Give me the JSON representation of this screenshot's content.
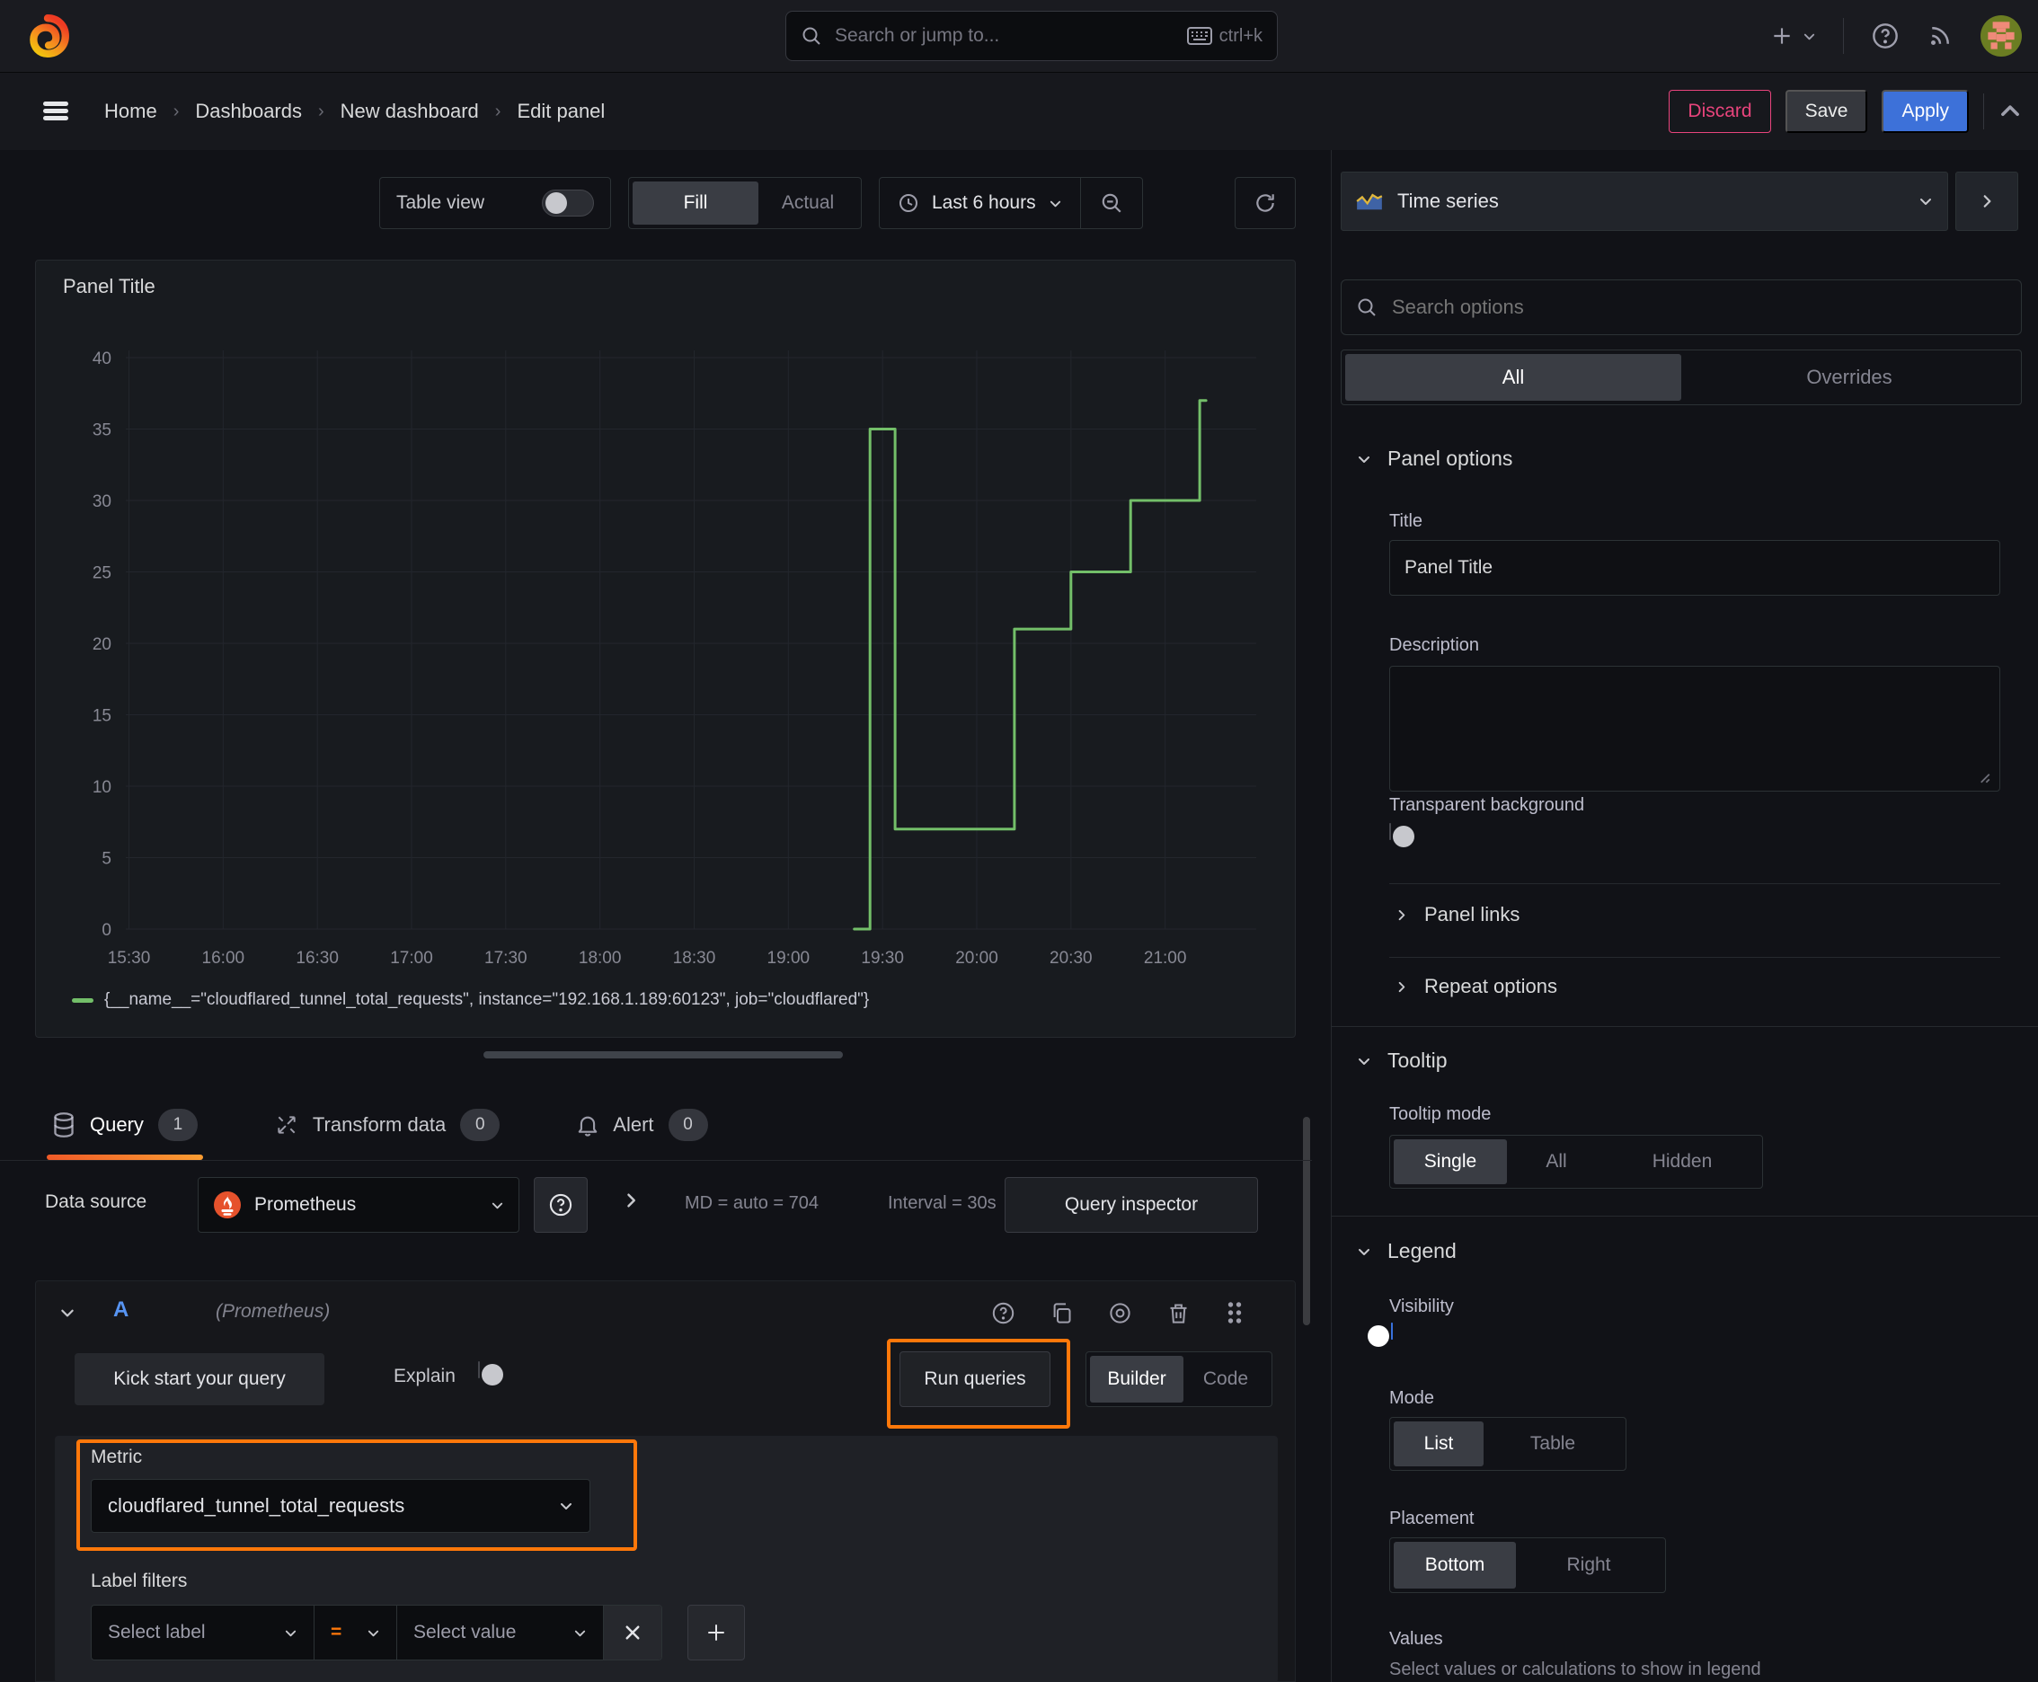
{
  "topbar": {
    "search_placeholder": "Search or jump to...",
    "shortcut": "ctrl+k"
  },
  "breadcrumb": {
    "items": [
      "Home",
      "Dashboards",
      "New dashboard",
      "Edit panel"
    ],
    "actions": {
      "discard": "Discard",
      "save": "Save",
      "apply": "Apply"
    }
  },
  "toolbar": {
    "table_view_label": "Table view",
    "fill_label": "Fill",
    "actual_label": "Actual",
    "time_range_label": "Last 6 hours"
  },
  "panel": {
    "title": "Panel Title"
  },
  "chart_data": {
    "type": "line",
    "style": "step",
    "title": "Panel Title",
    "xlabel": "",
    "ylabel": "",
    "grid": true,
    "legend_position": "bottom",
    "x_domain": [
      "15:29",
      "21:29"
    ],
    "x_ticks": [
      "15:30",
      "16:00",
      "16:30",
      "17:00",
      "17:30",
      "18:00",
      "18:30",
      "19:00",
      "19:30",
      "20:00",
      "20:30",
      "21:00"
    ],
    "y_ticks": [
      0,
      5,
      10,
      15,
      20,
      25,
      30,
      35,
      40
    ],
    "ylim": [
      0,
      40.5
    ],
    "series": [
      {
        "name": "{__name__=\"cloudflared_tunnel_total_requests\", instance=\"192.168.1.189:60123\", job=\"cloudflared\"}",
        "color": "#73bf69",
        "points": [
          [
            "19:21",
            0
          ],
          [
            "19:26",
            0
          ],
          [
            "19:26",
            35
          ],
          [
            "19:34",
            35
          ],
          [
            "19:34",
            7
          ],
          [
            "20:12",
            7
          ],
          [
            "20:12",
            21
          ],
          [
            "20:30",
            21
          ],
          [
            "20:30",
            25
          ],
          [
            "20:49",
            25
          ],
          [
            "20:49",
            30
          ],
          [
            "21:11",
            30
          ],
          [
            "21:11",
            37
          ],
          [
            "21:13",
            37
          ]
        ]
      }
    ]
  },
  "tabs": {
    "query": {
      "label": "Query",
      "count": "1"
    },
    "transform": {
      "label": "Transform data",
      "count": "0"
    },
    "alert": {
      "label": "Alert",
      "count": "0"
    }
  },
  "datasource_bar": {
    "label": "Data source",
    "selected": "Prometheus",
    "stats_md": "MD = auto = 704",
    "stats_interval": "Interval = 30s",
    "query_inspector_label": "Query inspector"
  },
  "query_editor": {
    "ref_id": "A",
    "datasource_hint": "(Prometheus)",
    "kick_start_label": "Kick start your query",
    "explain_label": "Explain",
    "run_queries_label": "Run queries",
    "builder_label": "Builder",
    "code_label": "Code",
    "metric": {
      "label": "Metric",
      "value": "cloudflared_tunnel_total_requests"
    },
    "label_filters": {
      "label": "Label filters",
      "select_label_placeholder": "Select label",
      "operator": "=",
      "select_value_placeholder": "Select value"
    }
  },
  "sidebar": {
    "visualization": "Time series",
    "search_placeholder": "Search options",
    "filter_tabs": {
      "all": "All",
      "overrides": "Overrides"
    },
    "panel_options": {
      "title": "Panel options",
      "title_label": "Title",
      "title_value": "Panel Title",
      "description_label": "Description",
      "transparent_label": "Transparent background",
      "panel_links": "Panel links",
      "repeat_options": "Repeat options"
    },
    "tooltip": {
      "title": "Tooltip",
      "mode_label": "Tooltip mode",
      "options": [
        "Single",
        "All",
        "Hidden"
      ],
      "selected": "Single"
    },
    "legend": {
      "title": "Legend",
      "visibility_label": "Visibility",
      "mode_label": "Mode",
      "mode_options": [
        "List",
        "Table"
      ],
      "placement_label": "Placement",
      "placement_options": [
        "Bottom",
        "Right"
      ],
      "values_label": "Values",
      "values_hint": "Select values or calculations to show in legend"
    }
  },
  "colors": {
    "highlight_orange": "#ff780a",
    "accent_blue": "#3d71d9",
    "series_green": "#73bf69",
    "discard_pink": "#e8447c",
    "tab_underline_start": "#f05a28",
    "tab_underline_end": "#fb9d32"
  }
}
